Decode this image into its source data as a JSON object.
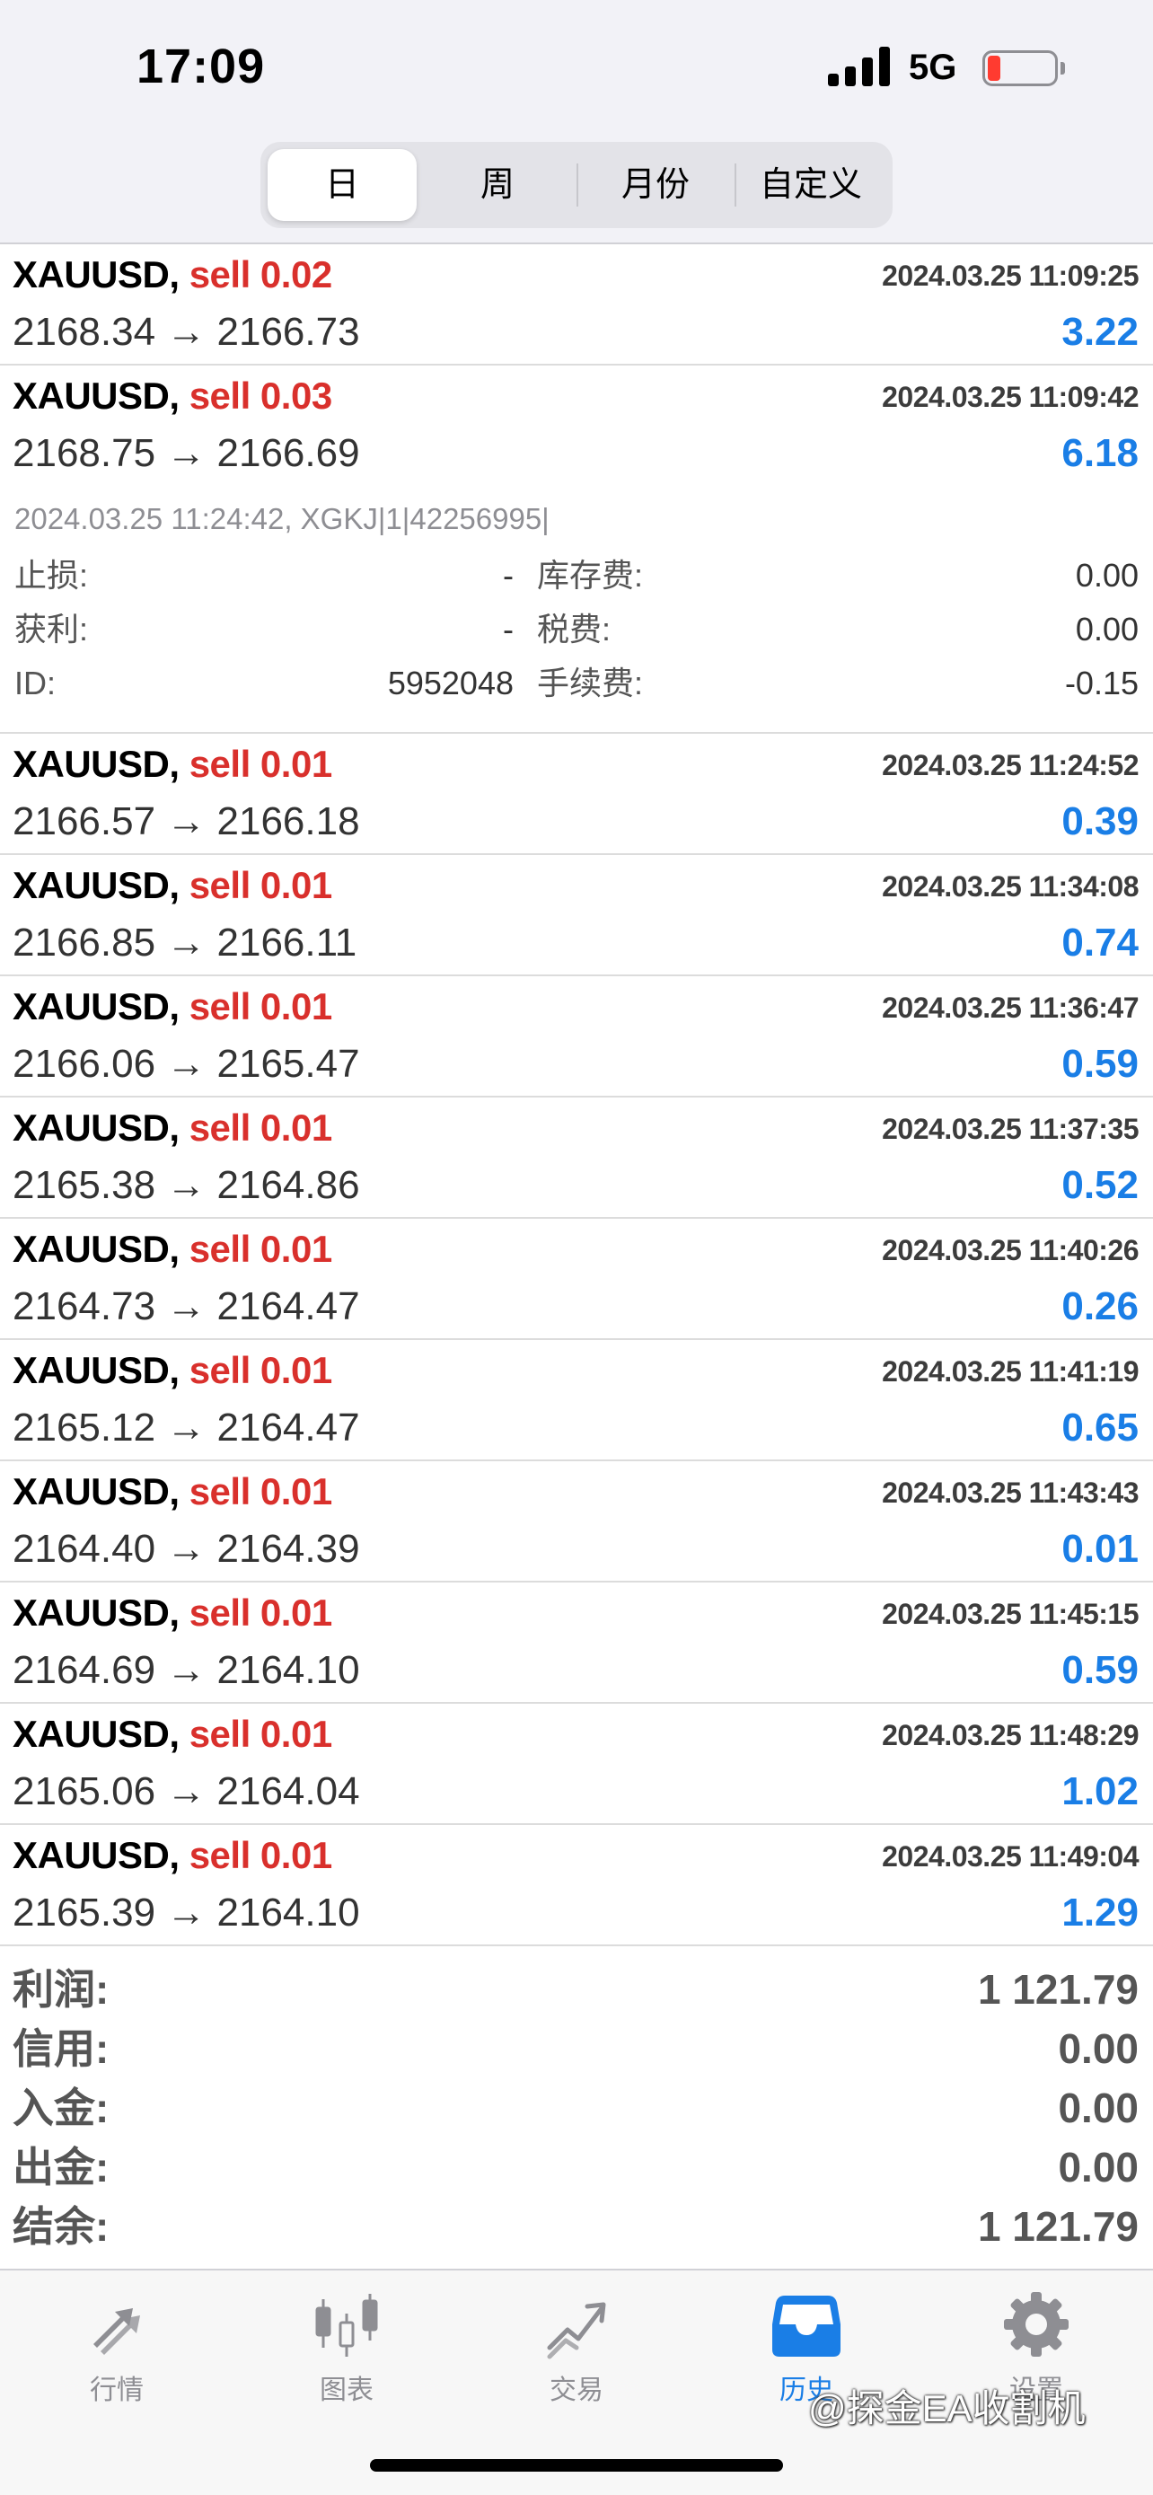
{
  "status_bar": {
    "time": "17:09",
    "network": "5G",
    "battery_color": "#ff3b30"
  },
  "period_tabs": [
    {
      "label": "日",
      "active": true
    },
    {
      "label": "周"
    },
    {
      "label": "月份"
    },
    {
      "label": "自定义"
    }
  ],
  "deals": [
    {
      "symbol": "XAUUSD,",
      "side": "sell 0.02",
      "time": "2024.03.25 11:09:25",
      "prices": "2168.34 → 2166.73",
      "profit": "3.22"
    },
    {
      "symbol": "XAUUSD,",
      "side": "sell 0.03",
      "time": "2024.03.25 11:09:42",
      "prices": "2168.75 → 2166.69",
      "profit": "6.18",
      "details": {
        "comment": "2024.03.25 11:24:42, XGKJ|1|42256995|",
        "sl_label": "止损:",
        "sl_value": "-",
        "tp_label": "获利:",
        "tp_value": "-",
        "id_label": "ID:",
        "id_value": "5952048",
        "swap_label": "库存费:",
        "swap_value": "0.00",
        "tax_label": "税费:",
        "tax_value": "0.00",
        "commission_label": "手续费:",
        "commission_value": "-0.15"
      }
    },
    {
      "symbol": "XAUUSD,",
      "side": "sell 0.01",
      "time": "2024.03.25 11:24:52",
      "prices": "2166.57 → 2166.18",
      "profit": "0.39"
    },
    {
      "symbol": "XAUUSD,",
      "side": "sell 0.01",
      "time": "2024.03.25 11:34:08",
      "prices": "2166.85 → 2166.11",
      "profit": "0.74"
    },
    {
      "symbol": "XAUUSD,",
      "side": "sell 0.01",
      "time": "2024.03.25 11:36:47",
      "prices": "2166.06 → 2165.47",
      "profit": "0.59"
    },
    {
      "symbol": "XAUUSD,",
      "side": "sell 0.01",
      "time": "2024.03.25 11:37:35",
      "prices": "2165.38 → 2164.86",
      "profit": "0.52"
    },
    {
      "symbol": "XAUUSD,",
      "side": "sell 0.01",
      "time": "2024.03.25 11:40:26",
      "prices": "2164.73 → 2164.47",
      "profit": "0.26"
    },
    {
      "symbol": "XAUUSD,",
      "side": "sell 0.01",
      "time": "2024.03.25 11:41:19",
      "prices": "2165.12 → 2164.47",
      "profit": "0.65"
    },
    {
      "symbol": "XAUUSD,",
      "side": "sell 0.01",
      "time": "2024.03.25 11:43:43",
      "prices": "2164.40 → 2164.39",
      "profit": "0.01"
    },
    {
      "symbol": "XAUUSD,",
      "side": "sell 0.01",
      "time": "2024.03.25 11:45:15",
      "prices": "2164.69 → 2164.10",
      "profit": "0.59"
    },
    {
      "symbol": "XAUUSD,",
      "side": "sell 0.01",
      "time": "2024.03.25 11:48:29",
      "prices": "2165.06 → 2164.04",
      "profit": "1.02"
    },
    {
      "symbol": "XAUUSD,",
      "side": "sell 0.01",
      "time": "2024.03.25 11:49:04",
      "prices": "2165.39 → 2164.10",
      "profit": "1.29"
    }
  ],
  "summary": [
    {
      "label": "利润:",
      "value": "1 121.79"
    },
    {
      "label": "信用:",
      "value": "0.00"
    },
    {
      "label": "入金:",
      "value": "0.00"
    },
    {
      "label": "出金:",
      "value": "0.00"
    },
    {
      "label": "结余:",
      "value": "1 121.79"
    }
  ],
  "tabs": [
    {
      "label": "行情",
      "icon": "quotes-arrows-icon"
    },
    {
      "label": "图表",
      "icon": "candlestick-chart-icon"
    },
    {
      "label": "交易",
      "icon": "trade-chart-icon"
    },
    {
      "label": "历史",
      "icon": "history-inbox-icon",
      "active": true
    },
    {
      "label": "设置",
      "icon": "gear-icon"
    }
  ],
  "watermark": "@探金EA收割机",
  "colors": {
    "accent": "#1a7ee6",
    "sell": "#d9302c",
    "inactive_icon": "#8e8e93"
  }
}
